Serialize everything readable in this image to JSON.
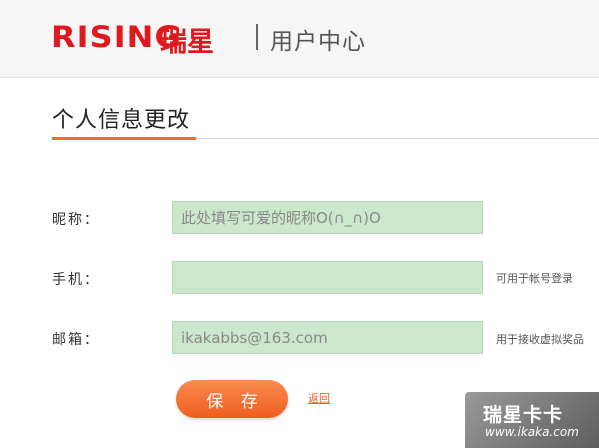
{
  "header": {
    "logo_en": "RISING",
    "logo_cn": "瑞星",
    "title": "用户中心",
    "brand_color": "#e0191e"
  },
  "page": {
    "title": "个人信息更改",
    "accent_color": "#f26b2e"
  },
  "form": {
    "nickname": {
      "label": "昵称：",
      "value": "",
      "placeholder": "此处填写可爱的昵称O(∩_∩)O"
    },
    "phone": {
      "label": "手机：",
      "value": "",
      "placeholder": "",
      "hint": "可用于帐号登录"
    },
    "email": {
      "label": "邮箱：",
      "value": "ikakabbs@163.com",
      "placeholder": "",
      "hint": "用于接收虚拟奖品"
    },
    "input_bg_color": "#cce8cc"
  },
  "actions": {
    "save_label": "保 存",
    "back_label": "返回"
  },
  "watermark": {
    "cn": "瑞星卡卡",
    "url": "www.ikaka.com"
  }
}
